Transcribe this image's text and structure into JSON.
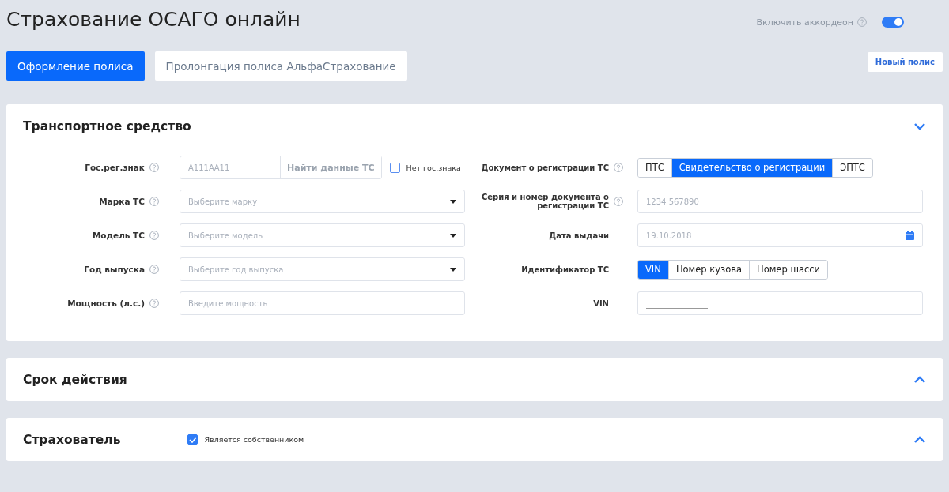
{
  "page_title": "Страхование ОСАГО онлайн",
  "accordion_toggle": {
    "label": "Включить аккордеон",
    "on": true
  },
  "tabs": [
    {
      "label": "Оформление полиса",
      "selected": true
    },
    {
      "label": "Пролонгация полиса АльфаСтрахование",
      "selected": false
    }
  ],
  "new_policy_button": "Новый полис",
  "sections": [
    {
      "title": "Транспортное средство",
      "expanded": true,
      "left_fields": [
        {
          "kind": "plate",
          "label": "Гос.рег.знак",
          "help": true,
          "placeholder": "А111АА11",
          "button": "Найти данные ТС",
          "checkbox": {
            "label": "Нет гос.знака",
            "checked": false
          }
        },
        {
          "kind": "select",
          "label": "Марка ТС",
          "help": true,
          "placeholder": "Выберите марку"
        },
        {
          "kind": "select",
          "label": "Модель ТС",
          "help": true,
          "placeholder": "Выберите модель"
        },
        {
          "kind": "select",
          "label": "Год выпуска",
          "help": true,
          "placeholder": "Выберите год выпуска"
        },
        {
          "kind": "input",
          "label": "Мощность (л.с.)",
          "help": true,
          "placeholder": "Введите мощность"
        }
      ],
      "right_fields": [
        {
          "kind": "segmented",
          "label": "Документ о регистрации ТС",
          "help": true,
          "options": [
            {
              "label": "ПТС",
              "selected": false
            },
            {
              "label": "Свидетельство о регистрации",
              "selected": true
            },
            {
              "label": "ЭПТС",
              "selected": false
            }
          ]
        },
        {
          "kind": "input",
          "label": "Серия и номер документа о регистрации ТС",
          "help": true,
          "placeholder": "1234 567890"
        },
        {
          "kind": "date",
          "label": "Дата выдачи",
          "help": false,
          "placeholder": "19.10.2018"
        },
        {
          "kind": "segmented",
          "label": "Идентификатор ТС",
          "help": false,
          "options": [
            {
              "label": "VIN",
              "selected": true
            },
            {
              "label": "Номер кузова",
              "selected": false
            },
            {
              "label": "Номер шасси",
              "selected": false
            }
          ]
        },
        {
          "kind": "mask",
          "label": "VIN",
          "help": false
        }
      ]
    },
    {
      "title": "Срок действия",
      "expanded": false
    },
    {
      "title": "Страхователь",
      "expanded": false,
      "checkbox": {
        "label": "Является собственником",
        "checked": true
      }
    }
  ]
}
